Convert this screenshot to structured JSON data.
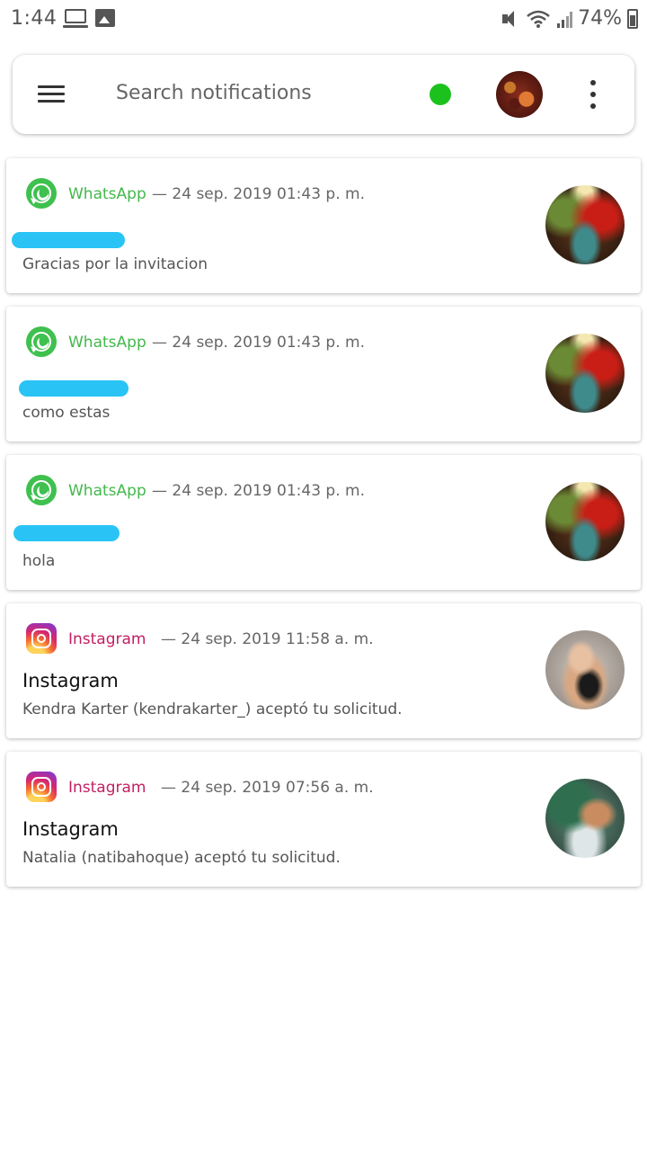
{
  "status_bar": {
    "time": "1:44",
    "battery": "74%",
    "icons": [
      "laptop-icon",
      "image-icon",
      "mute-icon",
      "wifi-icon",
      "signal-icon",
      "battery-icon"
    ]
  },
  "search": {
    "placeholder": "Search notifications",
    "status_color": "#1dc11d"
  },
  "notifications": [
    {
      "app": "WhatsApp",
      "time": "— 24 sep. 2019 01:43 p. m.",
      "title": "",
      "body": "Gracias por la invitacion"
    },
    {
      "app": "WhatsApp",
      "time": "— 24 sep. 2019 01:43 p. m.",
      "title": "",
      "body": "como estas"
    },
    {
      "app": "WhatsApp",
      "time": "— 24 sep. 2019 01:43 p. m.",
      "title": "",
      "body": "hola"
    },
    {
      "app": "Instagram",
      "time": "— 24 sep. 2019 11:58 a. m.",
      "title": "Instagram",
      "body": "Kendra Karter (kendrakarter_) aceptó tu solicitud."
    },
    {
      "app": "Instagram",
      "time": "— 24 sep. 2019 07:56 a. m.",
      "title": "Instagram",
      "body": "Natalia (natibahoque) aceptó tu solicitud."
    }
  ],
  "colors": {
    "whatsapp": "#43b84c",
    "instagram": "#c21f62",
    "redaction": "#29c4f5"
  }
}
